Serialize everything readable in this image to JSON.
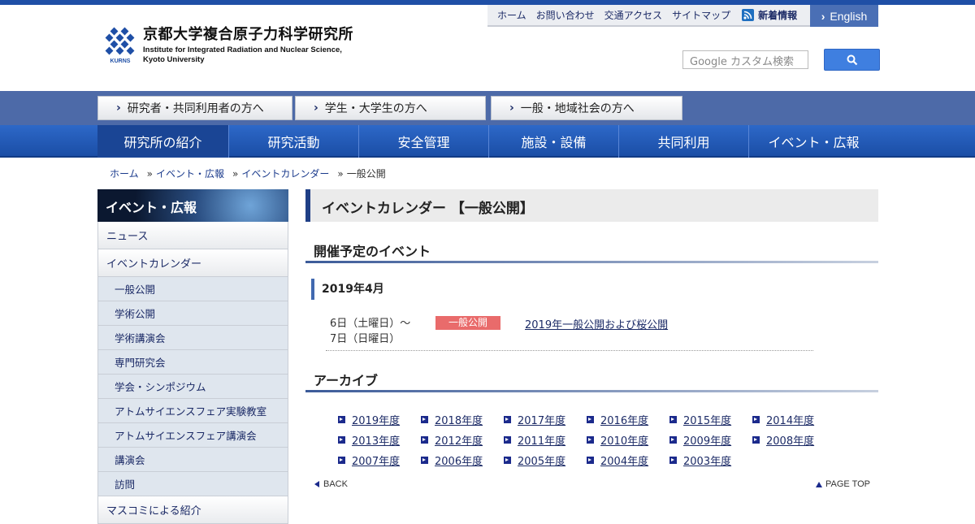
{
  "colors": {
    "brand_blue": "#1f4fa6",
    "nav_blue": "#2d68c8",
    "audience_band": "#4d6aa8",
    "badge_red": "#e96b6b",
    "link": "#1b2a66"
  },
  "header": {
    "logo_ja": "京都大学複合原子力科学研究所",
    "logo_en_1": "Institute for Integrated Radiation and Nuclear Science,",
    "logo_en_2": "Kyoto University",
    "logo_mark_text": "KURNS",
    "util_links": [
      "ホーム",
      "お問い合わせ",
      "交通アクセス",
      "サイトマップ"
    ],
    "rss_label": "新着情報",
    "english_label": "English",
    "search_placeholder": "Google カスタム検索",
    "search_icon": "search-icon"
  },
  "audience": [
    "研究者・共同利用者の方へ",
    "学生・大学生の方へ",
    "一般・地域社会の方へ"
  ],
  "global_nav": [
    "研究所の紹介",
    "研究活動",
    "安全管理",
    "施設・設備",
    "共同利用",
    "イベント・広報"
  ],
  "breadcrumb": {
    "items": [
      "ホーム",
      "イベント・広報",
      "イベントカレンダー"
    ],
    "current": "一般公開",
    "sep": "»"
  },
  "sidebar": {
    "heading": "イベント・広報",
    "items": [
      {
        "label": "ニュース",
        "level": "top"
      },
      {
        "label": "イベントカレンダー",
        "level": "top"
      },
      {
        "label": "一般公開",
        "level": "sub"
      },
      {
        "label": "学術公開",
        "level": "sub"
      },
      {
        "label": "学術講演会",
        "level": "sub"
      },
      {
        "label": "専門研究会",
        "level": "sub"
      },
      {
        "label": "学会・シンポジウム",
        "level": "sub"
      },
      {
        "label": "アトムサイエンスフェア実験教室",
        "level": "sub"
      },
      {
        "label": "アトムサイエンスフェア講演会",
        "level": "sub"
      },
      {
        "label": "講演会",
        "level": "sub"
      },
      {
        "label": "訪問",
        "level": "sub"
      },
      {
        "label": "マスコミによる紹介",
        "level": "top"
      }
    ]
  },
  "main": {
    "page_title": "イベントカレンダー 【一般公開】",
    "upcoming_heading": "開催予定のイベント",
    "month": "2019年4月",
    "event": {
      "date_line1": "6日（土曜日）〜",
      "date_line2": "7日（日曜日）",
      "badge": "一般公開",
      "title": "2019年一般公開および桜公開"
    },
    "archive_heading": "アーカイブ",
    "archive_years": [
      "2019年度",
      "2018年度",
      "2017年度",
      "2016年度",
      "2015年度",
      "2014年度",
      "2013年度",
      "2012年度",
      "2011年度",
      "2010年度",
      "2009年度",
      "2008年度",
      "2007年度",
      "2006年度",
      "2005年度",
      "2004年度",
      "2003年度"
    ],
    "back_label": "BACK",
    "pagetop_label": "PAGE TOP"
  }
}
